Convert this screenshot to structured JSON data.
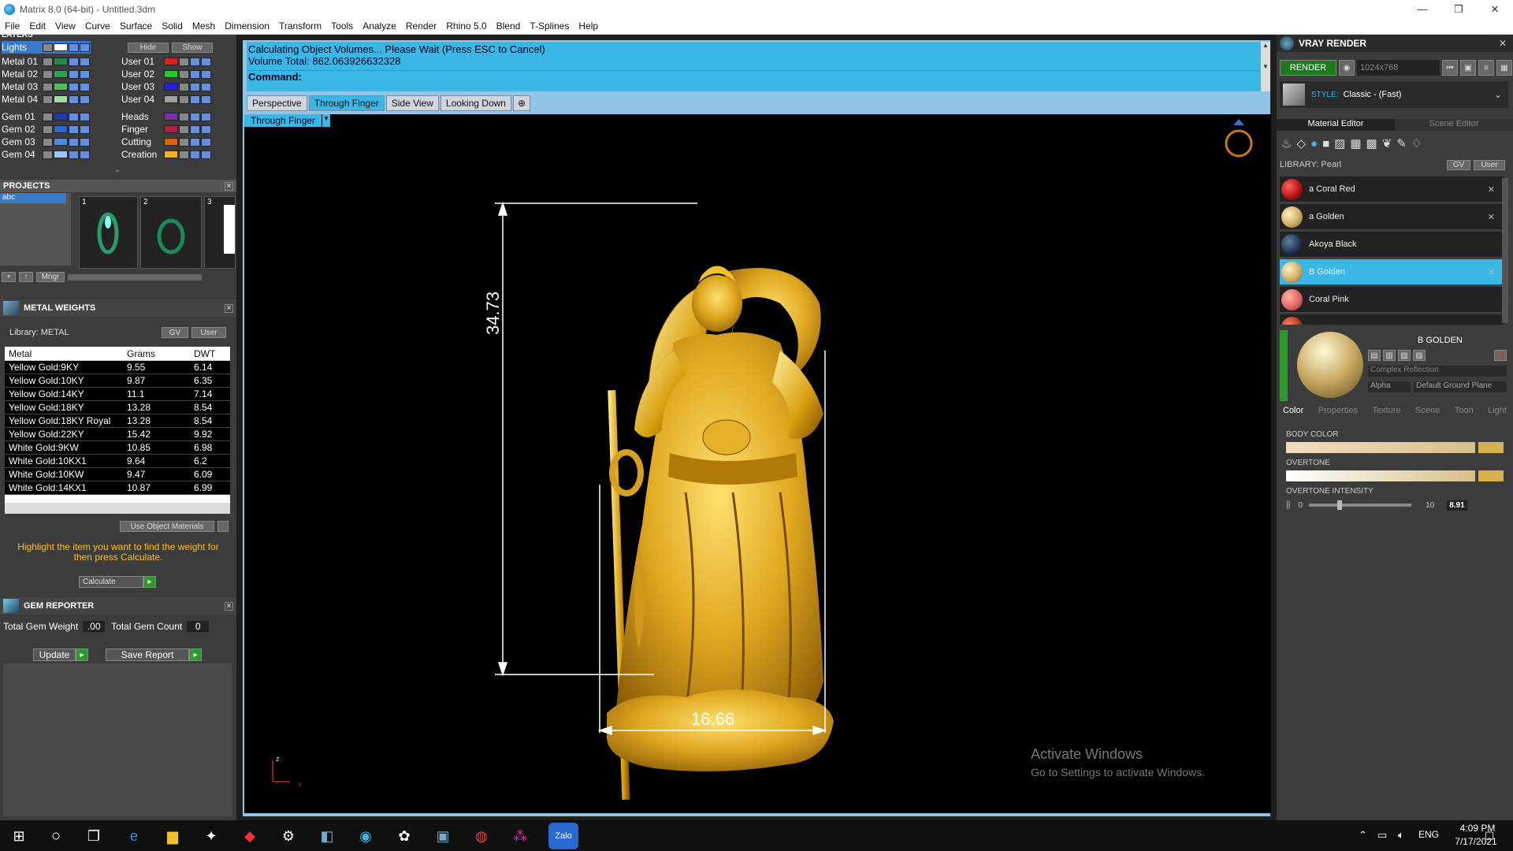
{
  "window": {
    "title": "Matrix 8.0 (64-bit) - Untitled.3dm",
    "min": "—",
    "max": "❐",
    "close": "✕"
  },
  "menu": [
    "File",
    "Edit",
    "View",
    "Curve",
    "Surface",
    "Solid",
    "Mesh",
    "Dimension",
    "Transform",
    "Tools",
    "Analyze",
    "Render",
    "Rhino 5.0",
    "Blend",
    "T-Splines",
    "Help"
  ],
  "layers": {
    "title": "LAYERS",
    "hide": "Hide",
    "show": "Show",
    "left": [
      {
        "name": "Lights",
        "color": "#ffffff",
        "selected": true
      },
      {
        "name": "Metal 01",
        "color": "#1f8a4c"
      },
      {
        "name": "Metal 02",
        "color": "#2fa050"
      },
      {
        "name": "Metal 03",
        "color": "#4cc060"
      },
      {
        "name": "Metal 04",
        "color": "#9fe0a0"
      },
      {
        "name": "Gem 01",
        "color": "#1f3ea8"
      },
      {
        "name": "Gem 02",
        "color": "#2f66d0"
      },
      {
        "name": "Gem 03",
        "color": "#4c8ae0"
      },
      {
        "name": "Gem 04",
        "color": "#9cc4f0"
      }
    ],
    "right": [
      {
        "name": "User 01",
        "color": "#e02020"
      },
      {
        "name": "User 02",
        "color": "#20d020"
      },
      {
        "name": "User 03",
        "color": "#2020e0"
      },
      {
        "name": "User 04",
        "color": "#a0a0a0"
      },
      {
        "name": "Heads",
        "color": "#7a2fb0"
      },
      {
        "name": "Finger",
        "color": "#b02040"
      },
      {
        "name": "Cutting",
        "color": "#e06010"
      },
      {
        "name": "Creation",
        "color": "#f0b020"
      }
    ]
  },
  "projects": {
    "title": "PROJECTS",
    "item": "abc",
    "thumbs": [
      "1",
      "2",
      "3"
    ],
    "mngr": "Mngr"
  },
  "metal_weights": {
    "title": "METAL WEIGHTS",
    "library": "Library: METAL",
    "gv": "GV",
    "user": "User",
    "cols": [
      "Metal",
      "Grams",
      "DWT"
    ],
    "rows": [
      [
        "Yellow Gold:9KY",
        "9.55",
        "6.14"
      ],
      [
        "Yellow Gold:10KY",
        "9.87",
        "6.35"
      ],
      [
        "Yellow Gold:14KY",
        "11.1",
        "7.14"
      ],
      [
        "Yellow Gold:18KY",
        "13.28",
        "8.54"
      ],
      [
        "Yellow Gold:18KY Royal",
        "13.28",
        "8.54"
      ],
      [
        "Yellow Gold:22KY",
        "15.42",
        "9.92"
      ],
      [
        "White Gold:9KW",
        "10.85",
        "6.98"
      ],
      [
        "White Gold:10KX1",
        "9.64",
        "6.2"
      ],
      [
        "White Gold:10KW",
        "9.47",
        "6.09"
      ],
      [
        "White Gold:14KX1",
        "10.87",
        "6.99"
      ]
    ],
    "use_object": "Use Object Materials",
    "hint": "Highlight the item you want to find the weight for then press Calculate.",
    "calculate": "Calculate"
  },
  "gem_reporter": {
    "title": "GEM REPORTER",
    "total_weight_label": "Total Gem Weight",
    "total_weight": ".00",
    "total_count_label": "Total Gem Count",
    "total_count": "0",
    "update": "Update",
    "save": "Save Report"
  },
  "command": {
    "line1": "Calculating Object Volumes... Please Wait (Press ESC to Cancel)",
    "line2": "Volume Total: 862.063926632328",
    "label": "Command:"
  },
  "tabs": [
    "Perspective",
    "Through Finger",
    "Side View",
    "Looking Down"
  ],
  "active_tab": "Through Finger",
  "viewport": {
    "label": "Through Finger",
    "dim_h": "34.73",
    "dim_w": "16.66",
    "axis_z": "z",
    "axis_x": "x",
    "watermark1": "Activate Windows",
    "watermark2": "Go to Settings to activate Windows."
  },
  "vray": {
    "title": "VRAY RENDER",
    "render": "RENDER",
    "resolution": "1024x768",
    "style_label": "STYLE:",
    "style_value": "Classic - (Fast)",
    "tab_material": "Material Editor",
    "tab_scene": "Scene Editor",
    "library": "LIBRARY: Pearl",
    "gv": "GV",
    "user": "User",
    "materials": [
      {
        "name": "a Coral Red",
        "color": "#b01010",
        "x": "✕"
      },
      {
        "name": "a Golden",
        "color": "#c8a860",
        "x": "✕"
      },
      {
        "name": "Akoya Black",
        "color": "#1c3050",
        "x": ""
      },
      {
        "name": "B Golden",
        "color": "#c8a860",
        "x": "✕",
        "selected": true
      },
      {
        "name": "Coral Pink",
        "color": "#e06060",
        "x": ""
      }
    ],
    "selected_name": "B GOLDEN",
    "complex": "Complex Reflection",
    "alpha": "Alpha",
    "ground": "Default Ground Plane",
    "subtabs": [
      "Color",
      "Properties",
      "Texture",
      "Scene",
      "Toon",
      "Light"
    ],
    "body_color": "BODY COLOR",
    "overtone": "OVERTONE",
    "overtone_intensity": "OVERTONE INTENSITY",
    "oi_min": "0",
    "oi_max": "10",
    "oi_value": "8.91"
  },
  "taskbar": {
    "lang": "ENG",
    "time": "4:09 PM",
    "date": "7/17/2021"
  }
}
